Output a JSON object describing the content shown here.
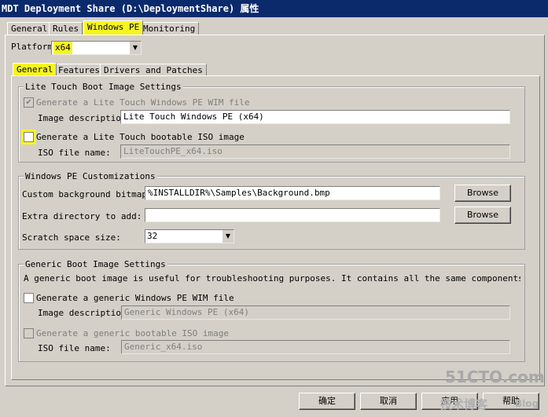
{
  "window": {
    "title": "MDT Deployment Share (D:\\DeploymentShare) 属性"
  },
  "top_tabs": [
    "General",
    "Rules",
    "Windows PE",
    "Monitoring"
  ],
  "platform": {
    "label": "Platform:",
    "value": "x64"
  },
  "sub_tabs": [
    "General",
    "Features",
    "Drivers and Patches"
  ],
  "lite_touch": {
    "group_label": "Lite Touch Boot Image Settings",
    "wim_checkbox_label": "Generate a Lite Touch Windows PE WIM file",
    "wim_checked": true,
    "image_desc_label": "Image description:",
    "image_desc_value": "Lite Touch Windows PE (x64)",
    "iso_checkbox_label": "Generate a Lite Touch bootable ISO image",
    "iso_checked": false,
    "iso_name_label": "ISO file name:",
    "iso_name_value": "LiteTouchPE_x64.iso"
  },
  "customizations": {
    "group_label": "Windows PE Customizations",
    "bg_label": "Custom background bitmap fi",
    "bg_value": "%INSTALLDIR%\\Samples\\Background.bmp",
    "browse_label": "Browse",
    "extra_label": "Extra directory to add:",
    "extra_value": "",
    "scratch_label": "Scratch space size:",
    "scratch_value": "32"
  },
  "generic": {
    "group_label": "Generic Boot Image Settings",
    "description": "A generic boot image is useful for troubleshooting purposes.  It contains all the same components and drivers,",
    "wim_checkbox_label": "Generate a generic Windows PE WIM file",
    "wim_checked": false,
    "image_desc_label": "Image description:",
    "image_desc_value": "Generic Windows PE (x64)",
    "iso_checkbox_label": "Generate a generic bootable ISO image",
    "iso_checked": false,
    "iso_name_label": "ISO file name:",
    "iso_name_value": "Generic_x64.iso"
  },
  "buttons": {
    "ok": "确定",
    "cancel": "取消",
    "apply": "应用",
    "help": "帮助"
  },
  "watermark": {
    "line1": "51CTO.com",
    "line2": "技术博客",
    "line3": "Blog"
  },
  "colors": {
    "highlight": "#f6f51e",
    "titlebar": "#0b2a6c",
    "dialog": "#d4d0c8"
  },
  "icons": {
    "check": "check-icon",
    "dropdown": "chevron-down-icon"
  }
}
